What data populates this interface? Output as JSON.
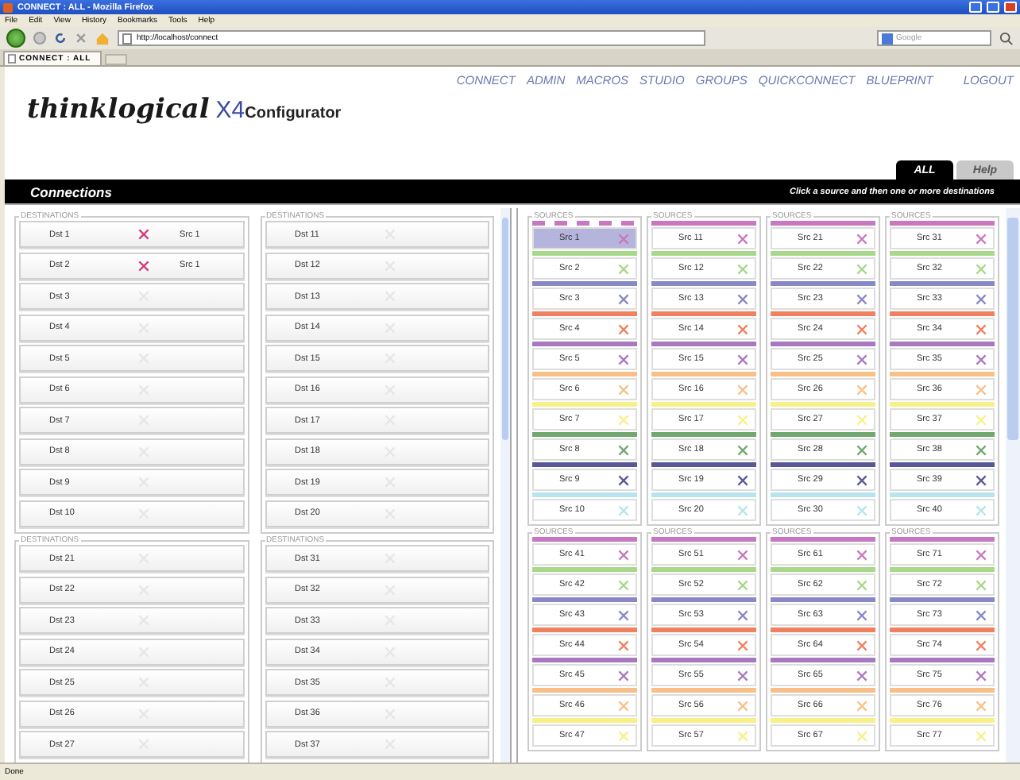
{
  "browser": {
    "title": "CONNECT : ALL - Mozilla Firefox",
    "menu": [
      "File",
      "Edit",
      "View",
      "History",
      "Bookmarks",
      "Tools",
      "Help"
    ],
    "url": "http://localhost/connect",
    "search_placeholder": "Google",
    "tab": "CONNECT : ALL",
    "status": "Done"
  },
  "nav": [
    "CONNECT",
    "ADMIN",
    "MACROS",
    "STUDIO",
    "GROUPS",
    "QUICKCONNECT",
    "BLUEPRINT"
  ],
  "logout": "LOGOUT",
  "logo": {
    "brand": "thinklogical",
    "product": "X4",
    "suffix": "Configurator"
  },
  "tabs": [
    {
      "label": "ALL",
      "selected": true
    },
    {
      "label": "Help",
      "selected": false
    }
  ],
  "bar": {
    "title": "Connections",
    "hint": "Click a source and then one or more destinations"
  },
  "destination_groups": [
    {
      "legend": "DESTINATIONS",
      "rows": [
        {
          "name": "Dst 1",
          "connected": true,
          "source": "Src 1"
        },
        {
          "name": "Dst 2",
          "connected": true,
          "source": "Src 1"
        },
        {
          "name": "Dst 3",
          "connected": false
        },
        {
          "name": "Dst 4",
          "connected": false
        },
        {
          "name": "Dst 5",
          "connected": false
        },
        {
          "name": "Dst 6",
          "connected": false
        },
        {
          "name": "Dst 7",
          "connected": false
        },
        {
          "name": "Dst 8",
          "connected": false
        },
        {
          "name": "Dst 9",
          "connected": false
        },
        {
          "name": "Dst 10",
          "connected": false
        }
      ]
    },
    {
      "legend": "DESTINATIONS",
      "rows": [
        {
          "name": "Dst 11",
          "connected": false
        },
        {
          "name": "Dst 12",
          "connected": false
        },
        {
          "name": "Dst 13",
          "connected": false
        },
        {
          "name": "Dst 14",
          "connected": false
        },
        {
          "name": "Dst 15",
          "connected": false
        },
        {
          "name": "Dst 16",
          "connected": false
        },
        {
          "name": "Dst 17",
          "connected": false
        },
        {
          "name": "Dst 18",
          "connected": false
        },
        {
          "name": "Dst 19",
          "connected": false
        },
        {
          "name": "Dst 20",
          "connected": false
        }
      ]
    },
    {
      "legend": "DESTINATIONS",
      "rows": [
        {
          "name": "Dst 21",
          "connected": false
        },
        {
          "name": "Dst 22",
          "connected": false
        },
        {
          "name": "Dst 23",
          "connected": false
        },
        {
          "name": "Dst 24",
          "connected": false
        },
        {
          "name": "Dst 25",
          "connected": false
        },
        {
          "name": "Dst 26",
          "connected": false
        },
        {
          "name": "Dst 27",
          "connected": false
        }
      ]
    },
    {
      "legend": "DESTINATIONS",
      "rows": [
        {
          "name": "Dst 31",
          "connected": false
        },
        {
          "name": "Dst 32",
          "connected": false
        },
        {
          "name": "Dst 33",
          "connected": false
        },
        {
          "name": "Dst 34",
          "connected": false
        },
        {
          "name": "Dst 35",
          "connected": false
        },
        {
          "name": "Dst 36",
          "connected": false
        },
        {
          "name": "Dst 37",
          "connected": false
        }
      ]
    }
  ],
  "source_groups": [
    {
      "legend": "SOURCES",
      "sources": [
        {
          "name": "Src 1",
          "color": "#c878c0",
          "selected": true
        },
        {
          "name": "Src 2",
          "color": "#a8d88a",
          "selected": false
        },
        {
          "name": "Src 3",
          "color": "#8888c8",
          "selected": false
        },
        {
          "name": "Src 4",
          "color": "#f08060",
          "selected": false
        },
        {
          "name": "Src 5",
          "color": "#a878c0",
          "selected": false
        },
        {
          "name": "Src 6",
          "color": "#f8c088",
          "selected": false
        },
        {
          "name": "Src 7",
          "color": "#f8f088",
          "selected": false
        },
        {
          "name": "Src 8",
          "color": "#70a870",
          "selected": false
        },
        {
          "name": "Src 9",
          "color": "#585898",
          "selected": false
        },
        {
          "name": "Src 10",
          "color": "#b8e4ee",
          "selected": false
        }
      ]
    },
    {
      "legend": "SOURCES",
      "sources": [
        {
          "name": "Src 11",
          "color": "#c878c0",
          "selected": false
        },
        {
          "name": "Src 12",
          "color": "#a8d88a",
          "selected": false
        },
        {
          "name": "Src 13",
          "color": "#8888c8",
          "selected": false
        },
        {
          "name": "Src 14",
          "color": "#f08060",
          "selected": false
        },
        {
          "name": "Src 15",
          "color": "#a878c0",
          "selected": false
        },
        {
          "name": "Src 16",
          "color": "#f8c088",
          "selected": false
        },
        {
          "name": "Src 17",
          "color": "#f8f088",
          "selected": false
        },
        {
          "name": "Src 18",
          "color": "#70a870",
          "selected": false
        },
        {
          "name": "Src 19",
          "color": "#585898",
          "selected": false
        },
        {
          "name": "Src 20",
          "color": "#b8e4ee",
          "selected": false
        }
      ]
    },
    {
      "legend": "SOURCES",
      "sources": [
        {
          "name": "Src 21",
          "color": "#c878c0",
          "selected": false
        },
        {
          "name": "Src 22",
          "color": "#a8d88a",
          "selected": false
        },
        {
          "name": "Src 23",
          "color": "#8888c8",
          "selected": false
        },
        {
          "name": "Src 24",
          "color": "#f08060",
          "selected": false
        },
        {
          "name": "Src 25",
          "color": "#a878c0",
          "selected": false
        },
        {
          "name": "Src 26",
          "color": "#f8c088",
          "selected": false
        },
        {
          "name": "Src 27",
          "color": "#f8f088",
          "selected": false
        },
        {
          "name": "Src 28",
          "color": "#70a870",
          "selected": false
        },
        {
          "name": "Src 29",
          "color": "#585898",
          "selected": false
        },
        {
          "name": "Src 30",
          "color": "#b8e4ee",
          "selected": false
        }
      ]
    },
    {
      "legend": "SOURCES",
      "sources": [
        {
          "name": "Src 31",
          "color": "#c878c0",
          "selected": false
        },
        {
          "name": "Src 32",
          "color": "#a8d88a",
          "selected": false
        },
        {
          "name": "Src 33",
          "color": "#8888c8",
          "selected": false
        },
        {
          "name": "Src 34",
          "color": "#f08060",
          "selected": false
        },
        {
          "name": "Src 35",
          "color": "#a878c0",
          "selected": false
        },
        {
          "name": "Src 36",
          "color": "#f8c088",
          "selected": false
        },
        {
          "name": "Src 37",
          "color": "#f8f088",
          "selected": false
        },
        {
          "name": "Src 38",
          "color": "#70a870",
          "selected": false
        },
        {
          "name": "Src 39",
          "color": "#585898",
          "selected": false
        },
        {
          "name": "Src 40",
          "color": "#b8e4ee",
          "selected": false
        }
      ]
    },
    {
      "legend": "SOURCES",
      "sources": [
        {
          "name": "Src 41",
          "color": "#c878c0",
          "selected": false
        },
        {
          "name": "Src 42",
          "color": "#a8d88a",
          "selected": false
        },
        {
          "name": "Src 43",
          "color": "#8888c8",
          "selected": false
        },
        {
          "name": "Src 44",
          "color": "#f08060",
          "selected": false
        },
        {
          "name": "Src 45",
          "color": "#a878c0",
          "selected": false
        },
        {
          "name": "Src 46",
          "color": "#f8c088",
          "selected": false
        },
        {
          "name": "Src 47",
          "color": "#f8f088",
          "selected": false
        }
      ]
    },
    {
      "legend": "SOURCES",
      "sources": [
        {
          "name": "Src 51",
          "color": "#c878c0",
          "selected": false
        },
        {
          "name": "Src 52",
          "color": "#a8d88a",
          "selected": false
        },
        {
          "name": "Src 53",
          "color": "#8888c8",
          "selected": false
        },
        {
          "name": "Src 54",
          "color": "#f08060",
          "selected": false
        },
        {
          "name": "Src 55",
          "color": "#a878c0",
          "selected": false
        },
        {
          "name": "Src 56",
          "color": "#f8c088",
          "selected": false
        },
        {
          "name": "Src 57",
          "color": "#f8f088",
          "selected": false
        }
      ]
    },
    {
      "legend": "SOURCES",
      "sources": [
        {
          "name": "Src 61",
          "color": "#c878c0",
          "selected": false
        },
        {
          "name": "Src 62",
          "color": "#a8d88a",
          "selected": false
        },
        {
          "name": "Src 63",
          "color": "#8888c8",
          "selected": false
        },
        {
          "name": "Src 64",
          "color": "#f08060",
          "selected": false
        },
        {
          "name": "Src 65",
          "color": "#a878c0",
          "selected": false
        },
        {
          "name": "Src 66",
          "color": "#f8c088",
          "selected": false
        },
        {
          "name": "Src 67",
          "color": "#f8f088",
          "selected": false
        }
      ]
    },
    {
      "legend": "SOURCES",
      "sources": [
        {
          "name": "Src 71",
          "color": "#c878c0",
          "selected": false
        },
        {
          "name": "Src 72",
          "color": "#a8d88a",
          "selected": false
        },
        {
          "name": "Src 73",
          "color": "#8888c8",
          "selected": false
        },
        {
          "name": "Src 74",
          "color": "#f08060",
          "selected": false
        },
        {
          "name": "Src 75",
          "color": "#a878c0",
          "selected": false
        },
        {
          "name": "Src 76",
          "color": "#f8c088",
          "selected": false
        },
        {
          "name": "Src 77",
          "color": "#f8f088",
          "selected": false
        }
      ]
    }
  ]
}
